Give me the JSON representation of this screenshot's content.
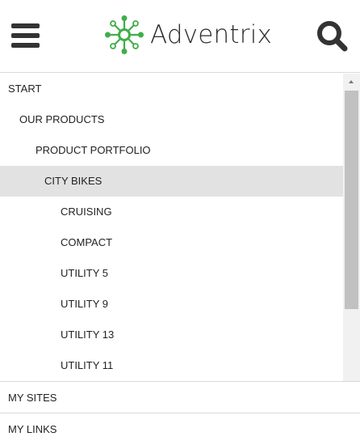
{
  "header": {
    "brand": "Adventrix",
    "brand_color": "#3fae49",
    "menu_icon": "hamburger-menu-icon",
    "logo_icon": "network-logo-icon",
    "search_icon": "magnifier-search-icon"
  },
  "tree": {
    "items": [
      {
        "label": "START",
        "level": 0,
        "active": false
      },
      {
        "label": "OUR PRODUCTS",
        "level": 1,
        "active": false
      },
      {
        "label": "PRODUCT PORTFOLIO",
        "level": 2,
        "active": false
      },
      {
        "label": "CITY BIKES",
        "level": 3,
        "active": true
      },
      {
        "label": "CRUISING",
        "level": 4,
        "active": false
      },
      {
        "label": "COMPACT",
        "level": 4,
        "active": false
      },
      {
        "label": "UTILITY 5",
        "level": 4,
        "active": false
      },
      {
        "label": "UTILITY 9",
        "level": 4,
        "active": false
      },
      {
        "label": "UTILITY 13",
        "level": 4,
        "active": false
      },
      {
        "label": "UTILITY 11",
        "level": 4,
        "active": false
      }
    ],
    "active_background": "#e2e2e2"
  },
  "sections": {
    "my_sites": "MY SITES",
    "my_links": "MY LINKS"
  }
}
